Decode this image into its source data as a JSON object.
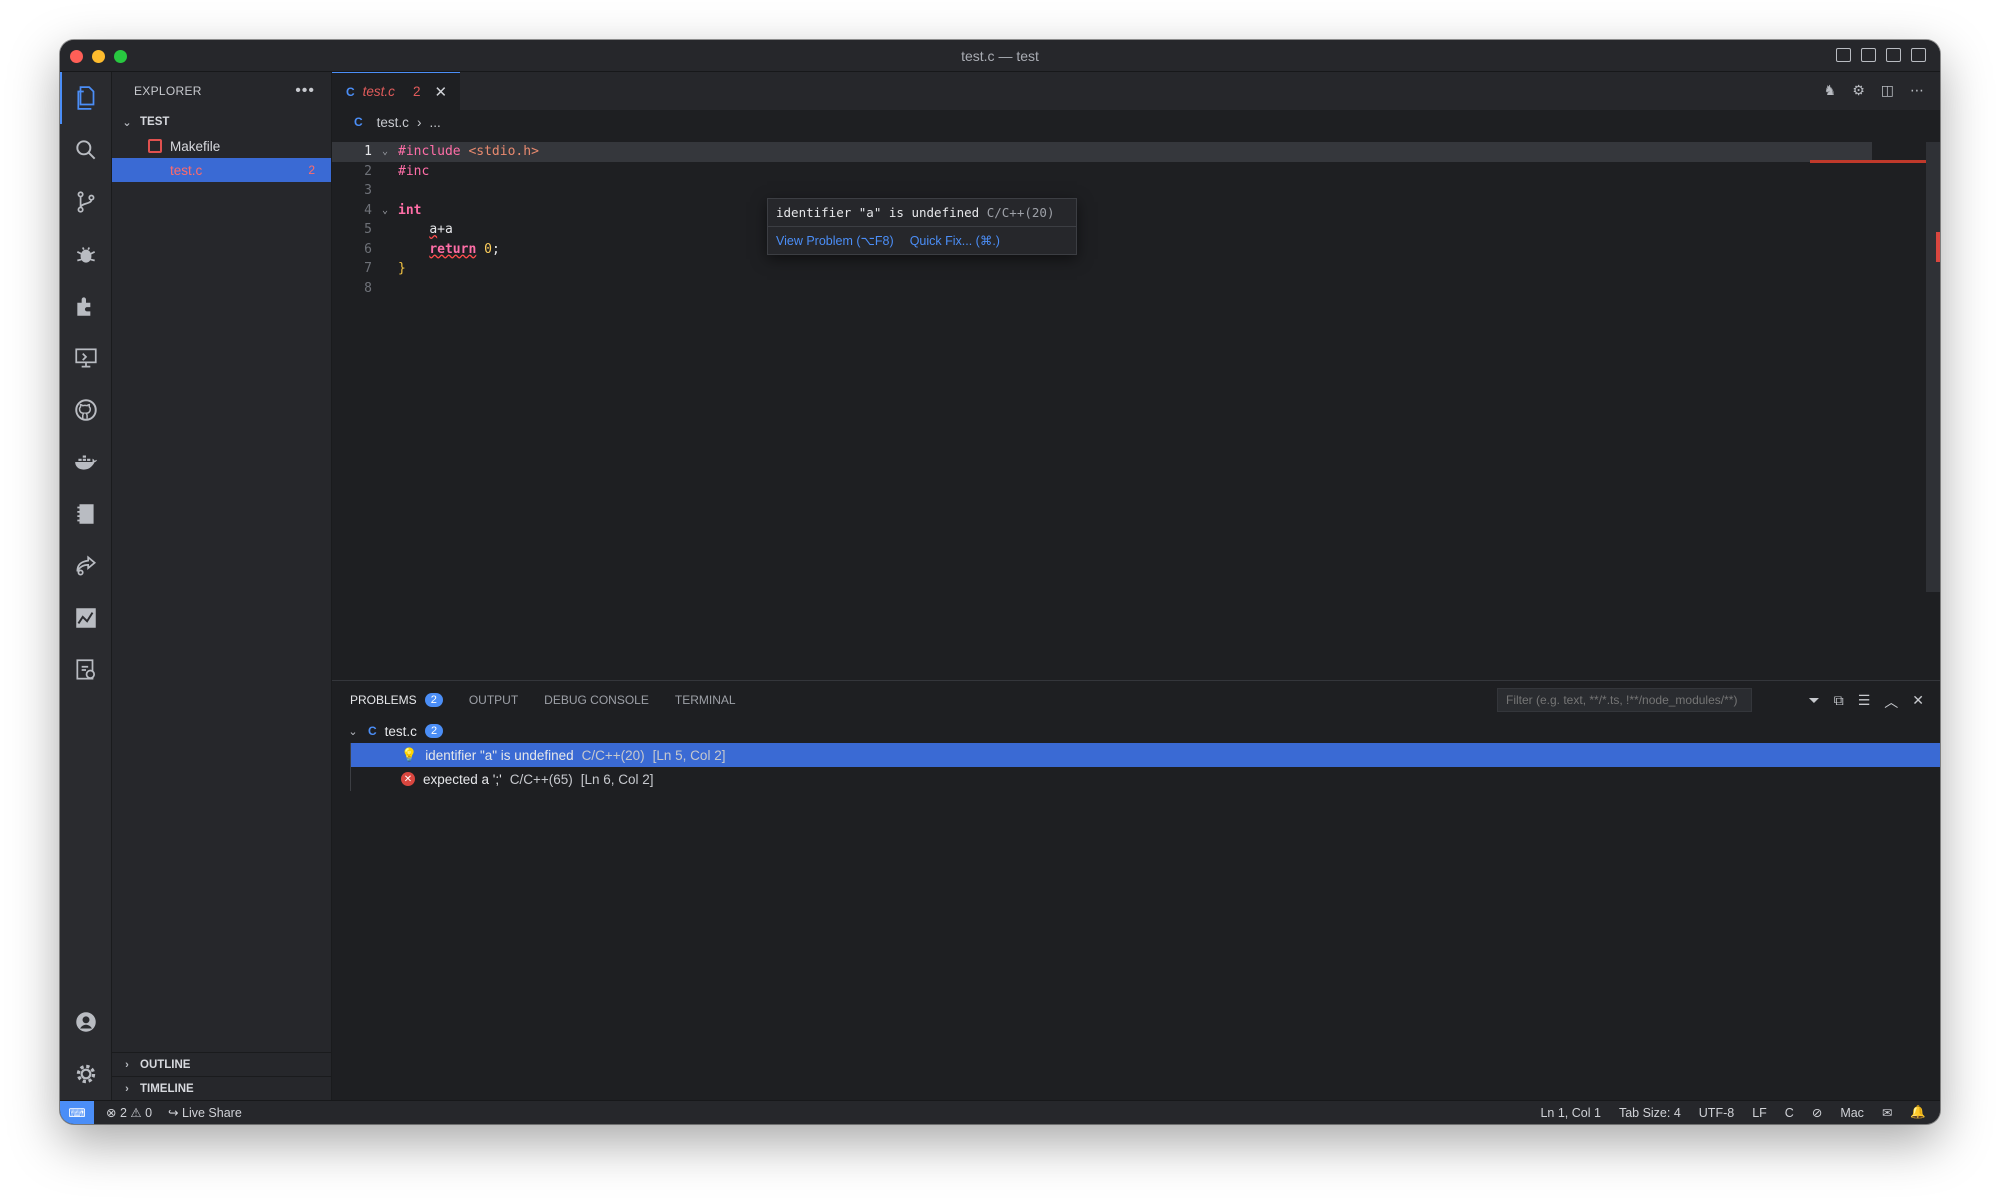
{
  "window": {
    "title": "test.c — test"
  },
  "explorer": {
    "title": "EXPLORER",
    "more": "•••",
    "folder": "TEST",
    "files": [
      {
        "name": "Makefile",
        "badge": ""
      },
      {
        "name": "test.c",
        "badge": "2"
      }
    ],
    "outline": "OUTLINE",
    "timeline": "TIMELINE"
  },
  "tab": {
    "name": "test.c",
    "count": "2",
    "close": "✕",
    "lang": "C"
  },
  "breadcrumb": {
    "file": "test.c",
    "sep": "›",
    "rest": "..."
  },
  "code": {
    "lines": [
      "1",
      "2",
      "3",
      "4",
      "5",
      "6",
      "7",
      "8"
    ],
    "l1_kw": "#include",
    "l1_str": "<stdio.h>",
    "l2_kw": "#inc",
    "l4_kw": "int",
    "l5_txt": "a",
    "l5_rest": "+a",
    "l6_kw": "return",
    "l6_num": "0",
    "l6_semi": ";",
    "l7": "}"
  },
  "hover": {
    "message": "identifier \"a\" is undefined",
    "source": "C/C++(20)",
    "view_problem": "View Problem (⌥F8)",
    "quick_fix": "Quick Fix... (⌘.)"
  },
  "panel": {
    "tabs": {
      "problems": "PROBLEMS",
      "problems_count": "2",
      "output": "OUTPUT",
      "debug": "DEBUG CONSOLE",
      "terminal": "TERMINAL"
    },
    "filter_placeholder": "Filter (e.g. text, **/*.ts, !**/node_modules/**)",
    "group": {
      "file": "test.c",
      "count": "2"
    },
    "problems": [
      {
        "message": "identifier \"a\" is undefined",
        "source": "C/C++(20)",
        "location": "[Ln 5, Col 2]"
      },
      {
        "message": "expected a ';'",
        "source": "C/C++(65)",
        "location": "[Ln 6, Col 2]"
      }
    ]
  },
  "status": {
    "errors": "2",
    "warnings": "0",
    "live_share": "Live Share",
    "position": "Ln 1, Col 1",
    "tab_size": "Tab Size: 4",
    "encoding": "UTF-8",
    "eol": "LF",
    "language": "C",
    "platform": "Mac"
  },
  "colors": {
    "accent": "#4b8ef7",
    "error": "#d9463f",
    "selection": "#3a6ad4"
  }
}
